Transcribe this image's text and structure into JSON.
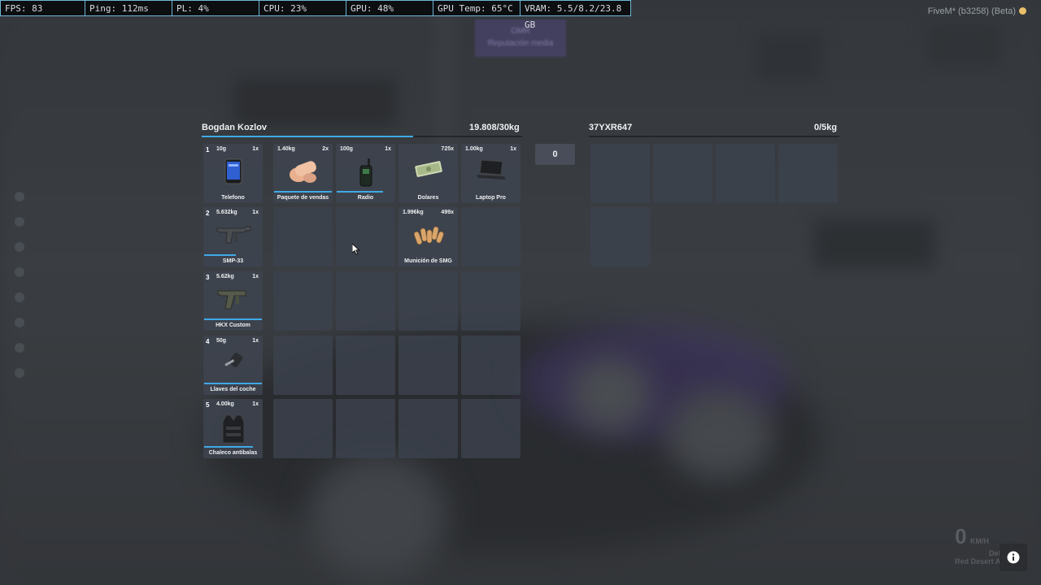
{
  "stats_bar": [
    {
      "label": "FPS: 83"
    },
    {
      "label": "Ping: 112ms"
    },
    {
      "label": "PL: 4%"
    },
    {
      "label": "CPU: 23%"
    },
    {
      "label": "GPU: 48%"
    },
    {
      "label": "GPU Temp: 65°C"
    },
    {
      "label": "VRAM: 5.5/8.2/23.8 GB"
    }
  ],
  "client_version": "FiveM* (b3258) (Beta)",
  "background_hud": {
    "line1": "OMR",
    "line2": "Reputación media"
  },
  "player": {
    "name": "Bogdan Kozlov",
    "weight": "19.808/30kg",
    "weight_fraction": 0.66
  },
  "amount_input": {
    "value": "0"
  },
  "vehicle": {
    "plate": "37YXR647",
    "weight": "0/5kg",
    "weight_fraction": 0.0
  },
  "hotbar": [
    {
      "slot": "1",
      "weight": "10g",
      "qty": "1x",
      "name": "Telefono",
      "icon": "phone-icon",
      "durability": null
    },
    {
      "slot": "2",
      "weight": "5.632kg",
      "qty": "1x",
      "name": "SMP-33",
      "icon": "smg-icon",
      "durability": 0.55
    },
    {
      "slot": "3",
      "weight": "5.62kg",
      "qty": "1x",
      "name": "HKX Custom",
      "icon": "pistol-icon",
      "durability": 1.0
    },
    {
      "slot": "4",
      "weight": "50g",
      "qty": "1x",
      "name": "Llaves del coche",
      "icon": "car-key-icon",
      "durability": 1.0
    },
    {
      "slot": "5",
      "weight": "4.00kg",
      "qty": "1x",
      "name": "Chaleco antibalas",
      "icon": "vest-icon",
      "durability": 0.85
    }
  ],
  "grid_items": [
    {
      "weight": "1.40kg",
      "qty": "2x",
      "name": "Paquete de vendas",
      "icon": "bandage-icon",
      "durability": 1.0
    },
    {
      "weight": "100g",
      "qty": "1x",
      "name": "Radio",
      "icon": "radio-icon",
      "durability": 0.8
    },
    {
      "weight": "",
      "qty": "725x",
      "name": "Dolares",
      "icon": "cash-icon",
      "durability": null
    },
    {
      "weight": "1.00kg",
      "qty": "1x",
      "name": "Laptop Pro",
      "icon": "laptop-icon",
      "durability": null
    },
    {
      "weight": "1.996kg",
      "qty": "499x",
      "name": "Munición de SMG",
      "icon": "ammo-icon",
      "durability": null
    }
  ],
  "speedometer": {
    "speed": "0",
    "unit": "KM/H",
    "street": "Del Perro",
    "area": "Red Desert Avenue"
  },
  "colors": {
    "accent": "#3fa9e6",
    "slot_bg": "#3e4450",
    "stats_border": "#6fb6d6"
  }
}
